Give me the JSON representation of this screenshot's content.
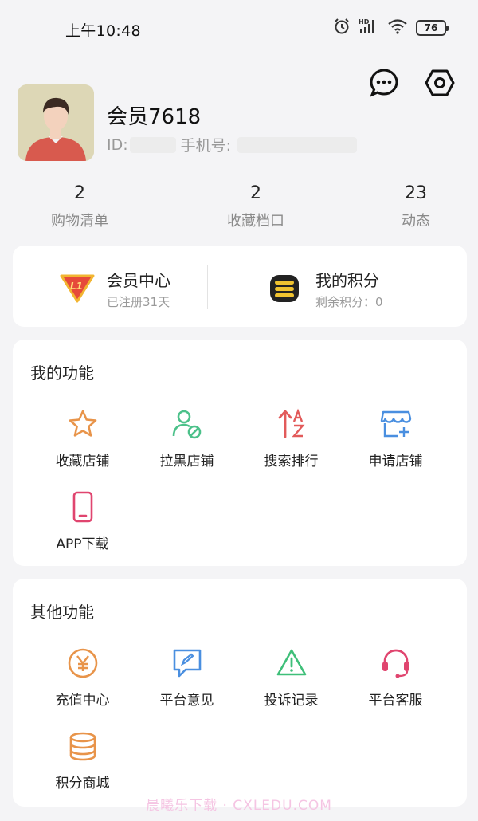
{
  "status_bar": {
    "time": "上午10:48",
    "battery": "76",
    "network": "HD"
  },
  "top_actions": {
    "message_icon": "chat-bubble-icon",
    "settings_icon": "hexagon-settings-icon"
  },
  "profile": {
    "username": "会员7618",
    "id_label": "ID:",
    "phone_label": "手机号:"
  },
  "stats": [
    {
      "value": "2",
      "label": "购物清单"
    },
    {
      "value": "2",
      "label": "收藏档口"
    },
    {
      "value": "23",
      "label": "动态"
    }
  ],
  "member": {
    "center_title": "会员中心",
    "center_sub": "已注册31天",
    "level_badge": "L1",
    "points_title": "我的积分",
    "points_sub": "剩余积分：0"
  },
  "my_functions": {
    "title": "我的功能",
    "items": [
      {
        "label": "收藏店铺",
        "icon": "star-icon"
      },
      {
        "label": "拉黑店铺",
        "icon": "user-block-icon"
      },
      {
        "label": "搜索排行",
        "icon": "sort-az-icon"
      },
      {
        "label": "申请店铺",
        "icon": "store-add-icon"
      },
      {
        "label": "APP下载",
        "icon": "phone-icon"
      }
    ]
  },
  "other_functions": {
    "title": "其他功能",
    "items": [
      {
        "label": "充值中心",
        "icon": "yen-coin-icon"
      },
      {
        "label": "平台意见",
        "icon": "feedback-icon"
      },
      {
        "label": "投诉记录",
        "icon": "warning-icon"
      },
      {
        "label": "平台客服",
        "icon": "headset-icon"
      },
      {
        "label": "积分商城",
        "icon": "coin-stack-icon"
      }
    ]
  },
  "watermark": "晨曦乐下载 · CXLEDU.COM",
  "colors": {
    "star": "#e8944a",
    "block": "#4cc18a",
    "sort": "#e25a5a",
    "store": "#4a8fe0",
    "phone": "#e0456f",
    "yen": "#e8944a",
    "feedback": "#4a8fe0",
    "warning": "#3fbf79",
    "headset": "#e0456f",
    "coin": "#e8944a"
  }
}
